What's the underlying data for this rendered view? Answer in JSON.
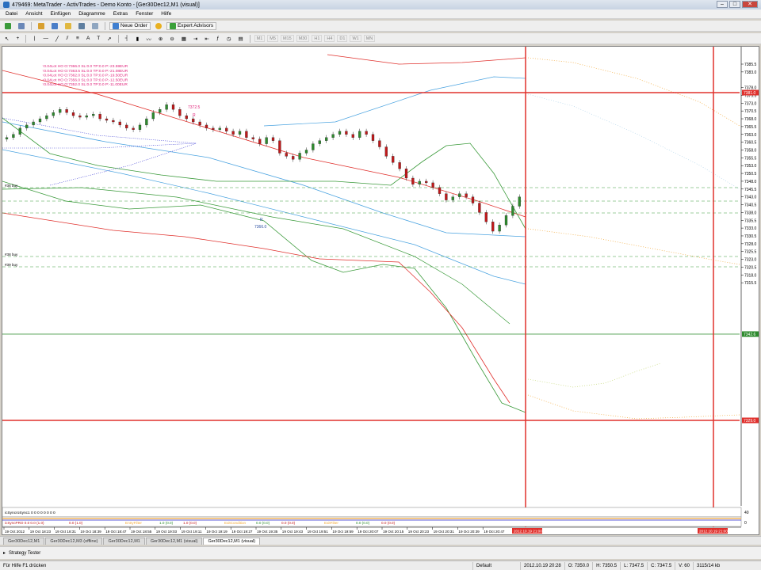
{
  "window": {
    "title": "479469: MetaTrader - ActivTrades - Demo Konto - [Ger30Dec12,M1 (visual)]"
  },
  "menu": [
    "Datei",
    "Ansicht",
    "Einfügen",
    "Diagramme",
    "Extras",
    "Fenster",
    "Hilfe"
  ],
  "toolbar": {
    "new_order": "Neue Order",
    "expert_advisors": "Expert Advisors",
    "periods": [
      "M1",
      "M5",
      "M15",
      "M30",
      "H1",
      "H4",
      "D1",
      "W1",
      "MN"
    ]
  },
  "chart": {
    "price_labels": [
      "7385.5",
      "7383.0",
      "7378.0",
      "7375.5",
      "7373.0",
      "7370.5",
      "7368.0",
      "7365.5",
      "7363.0",
      "7360.5",
      "7358.0",
      "7355.5",
      "7353.0",
      "7350.5",
      "7348.0",
      "7345.5",
      "7343.0",
      "7340.5",
      "7338.0",
      "7335.5",
      "7333.0",
      "7330.5",
      "7328.0",
      "7325.5",
      "7323.0",
      "7320.5",
      "7318.0",
      "7315.5"
    ],
    "price_tags": {
      "upper": "7381.0",
      "current": "7342.6",
      "lower": "7329.0"
    },
    "time_labels": [
      "19 Oct 2012",
      "19 Oct 18:23",
      "19 Oct 18:31",
      "19 Oct 18:39",
      "19 Oct 18:47",
      "19 Oct 18:55",
      "19 Oct 19:03",
      "19 Oct 19:11",
      "19 Oct 19:19",
      "19 Oct 19:27",
      "19 Oct 19:35",
      "19 Oct 19:43",
      "19 Oct 19:51",
      "19 Oct 19:59",
      "19 Oct 20:07",
      "19 Oct 20:15",
      "19 Oct 20:23",
      "19 Oct 20:31",
      "19 Oct 20:39",
      "19 Oct 20:47"
    ],
    "time_tags": [
      "2012.10.19 21:00",
      "2012.10.19 21:00"
    ],
    "orders": [
      "0.04Lot HO O:7366.0 SL:0.0 TP:0.0 P:-23.59EUR",
      "0.04Lot HO O:7363.5 SL:0.0 TP:0.0 P:-21.08EUR",
      "0.04Lot HO O:7362.0 SL:0.0 TP:0.0 P:-19.50EUR",
      "0.04Lot HO O:7356.0 SL:0.0 TP:0.0 P:-12.50EUR",
      "0.04Lot HO O:7352.0 SL:0.0 TP:0.0 P:-11.00EUR"
    ],
    "level_labels": [
      "#36 buy",
      "#38 buy",
      "#39 buy"
    ],
    "annotations": {
      "top_price": "7372.5",
      "top_letter": "R",
      "mid_price": "7366.0",
      "mid_letter": "R"
    },
    "indicator1": {
      "label": "icSyncroSync1 0 0 0 0 0 0 0 0",
      "right": "40"
    },
    "indicator2": {
      "label": "icSyncPRO 0.0 0.0 (1.0)",
      "items": [
        "0.0 (1.0)",
        "EntryFilter",
        "1.0 (0.0)",
        "1.0 (0.0)",
        "ExitCondition",
        "0.0 (0.0)",
        "0.0 (0.0)",
        "ExitFilter",
        "0.0 (0.0)",
        "0.0 (0.0)"
      ],
      "right": "0"
    },
    "colors": {
      "bull": "#2e8b2e",
      "bear": "#c0191b",
      "red_line": "#e0302c",
      "blue_line": "#4aa3e0",
      "green_line": "#3a9a3a"
    }
  },
  "tabs": [
    "Ger30Dec12,M1",
    "Ger30Dec12,M3 (offline)",
    "Ger30Dec12,M1",
    "Ger30Dec12,M1 (visual)",
    "Ger30Dec12,M1 (visual)"
  ],
  "tester": {
    "label": "Strategy Tester"
  },
  "status": {
    "help": "Für Hilfe F1 drücken",
    "profile": "Default",
    "datetime": "2012.10.19 20:28",
    "open": "O: 7350.0",
    "high": "H: 7350.5",
    "low": "L: 7347.5",
    "close": "C: 7347.5",
    "volume": "V: 60",
    "traffic": "3115/14 kb"
  }
}
